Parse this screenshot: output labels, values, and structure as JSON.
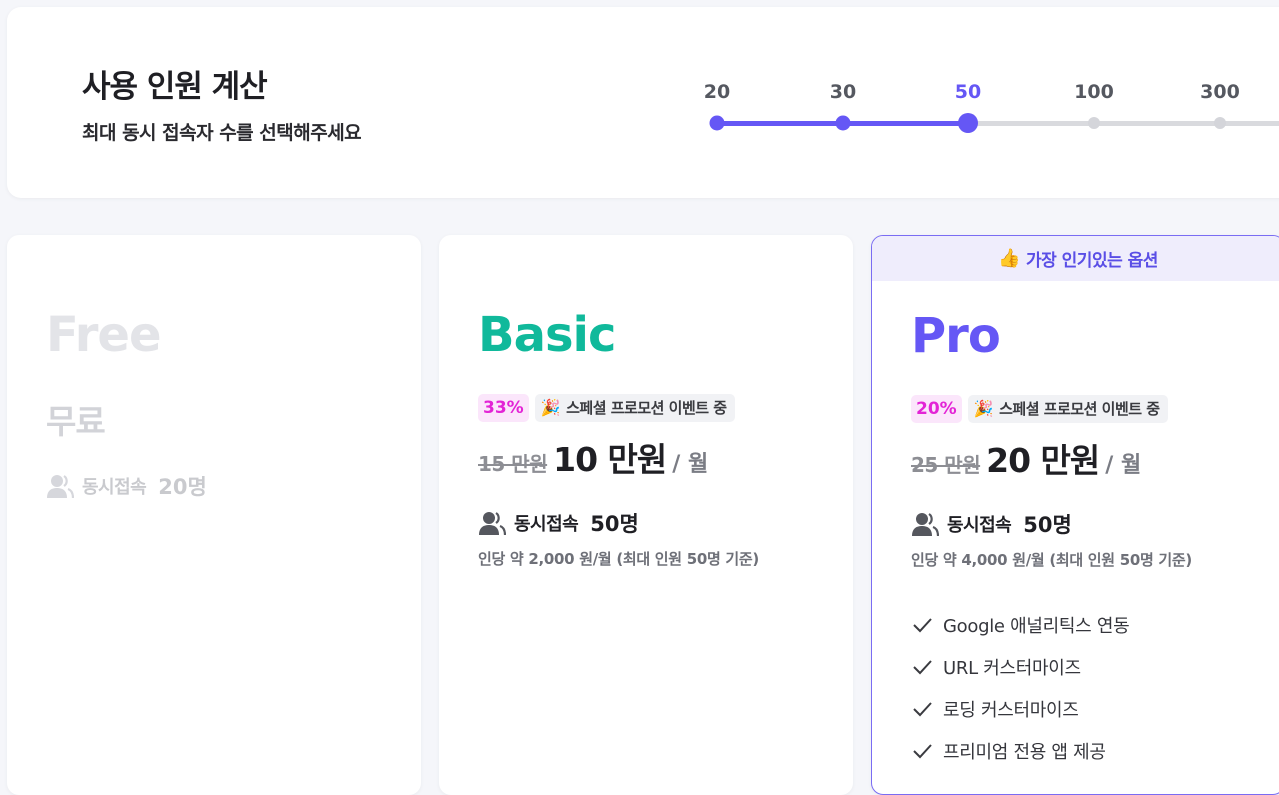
{
  "calculator": {
    "title": "사용 인원 계산",
    "subtitle": "최대 동시 접속자 수를 선택해주세요",
    "slider": {
      "options": [
        "20",
        "30",
        "50",
        "100",
        "300"
      ],
      "selected": "50",
      "accent_color": "#6557f5"
    }
  },
  "plans": {
    "free": {
      "name": "Free",
      "price_label": "무료",
      "concurrency_label": "동시접속",
      "concurrency_value": "20명",
      "name_color": "#e3e4e8"
    },
    "basic": {
      "name": "Basic",
      "discount": "33%",
      "promo": "스페셜 프로모션 이벤트 중",
      "old_price": "15 만원",
      "new_price": "10 만원",
      "per_month": "/ 월",
      "concurrency_label": "동시접속",
      "concurrency_value": "50명",
      "per_person": "인당 약 2,000 원/월 (최대 인원 50명 기준)",
      "name_color": "#10b99b"
    },
    "pro": {
      "banner": "가장 인기있는 옵션",
      "name": "Pro",
      "discount": "20%",
      "promo": "스페셜 프로모션 이벤트 중",
      "old_price": "25 만원",
      "new_price": "20 만원",
      "per_month": "/ 월",
      "concurrency_label": "동시접속",
      "concurrency_value": "50명",
      "per_person": "인당 약 4,000 원/월 (최대 인원 50명 기준)",
      "features": [
        "Google 애널리틱스 연동",
        "URL 커스터마이즈",
        "로딩 커스터마이즈",
        "프리미엄 전용 앱 제공"
      ],
      "name_color": "#6557f5"
    }
  },
  "icons": {
    "users": "users-icon",
    "check": "check-icon",
    "thumbs_up": "thumbs-up-icon",
    "party": "party-popper-icon"
  }
}
